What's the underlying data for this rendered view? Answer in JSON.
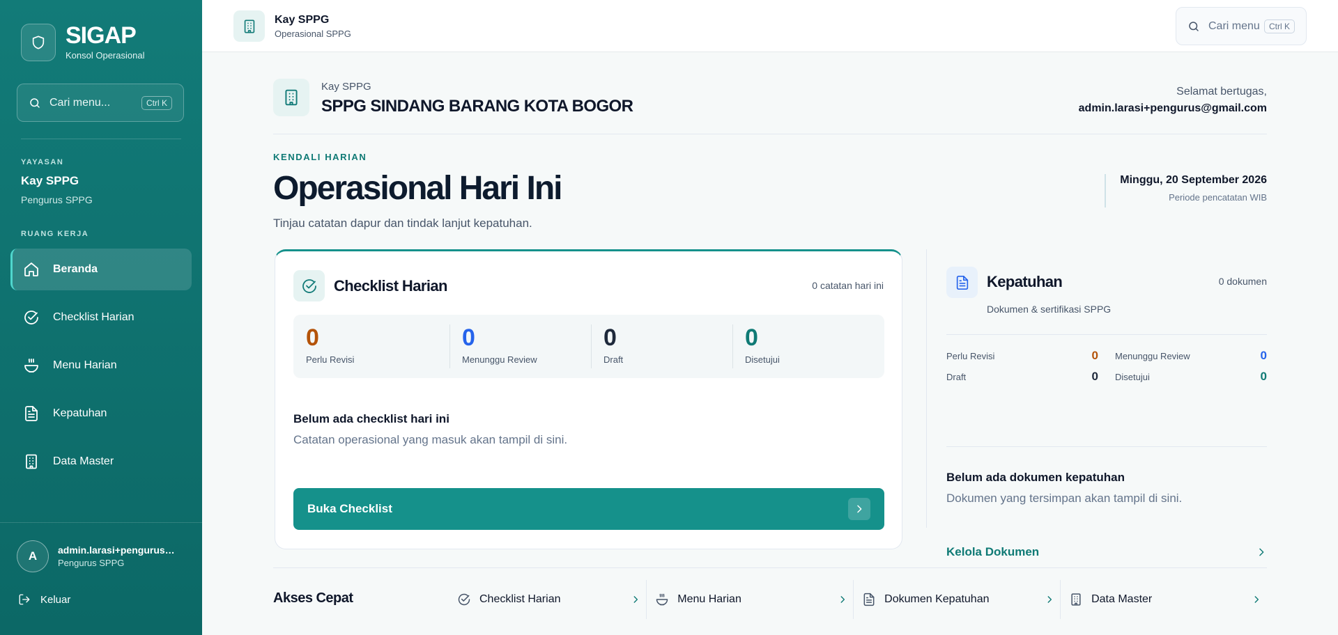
{
  "brand": {
    "title": "SIGAP",
    "subtitle": "Konsol Operasional"
  },
  "sidebar": {
    "search": {
      "placeholder": "Cari menu...",
      "shortcut": "Ctrl K"
    },
    "org_label": "YAYASAN",
    "org_name": "Kay SPPG",
    "org_role": "Pengurus SPPG",
    "workspace_label": "RUANG KERJA",
    "items": [
      {
        "label": "Beranda",
        "icon": "home-icon",
        "active": true
      },
      {
        "label": "Checklist Harian",
        "icon": "check-circle-icon"
      },
      {
        "label": "Menu Harian",
        "icon": "bowl-icon"
      },
      {
        "label": "Kepatuhan",
        "icon": "document-icon"
      },
      {
        "label": "Data Master",
        "icon": "building-icon"
      }
    ],
    "user": {
      "initial": "A",
      "email": "admin.larasi+pengurus@gmail.com",
      "role": "Pengurus SPPG"
    },
    "logout_label": "Keluar"
  },
  "topbar": {
    "title": "Kay SPPG",
    "subtitle": "Operasional SPPG",
    "search": {
      "placeholder": "Cari menu",
      "shortcut": "Ctrl K"
    }
  },
  "site": {
    "pre": "Kay SPPG",
    "name": "SPPG SINDANG BARANG KOTA BOGOR",
    "greeting": "Selamat bertugas,",
    "email": "admin.larasi+pengurus@gmail.com"
  },
  "page": {
    "eyebrow": "KENDALI HARIAN",
    "title": "Operasional Hari Ini",
    "description": "Tinjau catatan dapur dan tindak lanjut kepatuhan.",
    "date": "Minggu, 20 September 2026",
    "date_note": "Periode pencatatan WIB"
  },
  "checklist": {
    "title": "Checklist Harian",
    "count_text": "0 catatan hari ini",
    "stats": [
      {
        "value": "0",
        "label": "Perlu Revisi",
        "color": "#b45309"
      },
      {
        "value": "0",
        "label": "Menunggu Review",
        "color": "#2563eb"
      },
      {
        "value": "0",
        "label": "Draft",
        "color": "#1e293b"
      },
      {
        "value": "0",
        "label": "Disetujui",
        "color": "#0f7a75"
      }
    ],
    "empty_title": "Belum ada checklist hari ini",
    "empty_desc": "Catatan operasional yang masuk akan tampil di sini.",
    "cta": "Buka Checklist"
  },
  "compliance": {
    "title": "Kepatuhan",
    "count_text": "0 dokumen",
    "subtitle": "Dokumen & sertifikasi SPPG",
    "stats": [
      {
        "label": "Perlu Revisi",
        "value": "0",
        "color": "#b45309"
      },
      {
        "label": "Menunggu Review",
        "value": "0",
        "color": "#2563eb"
      },
      {
        "label": "Draft",
        "value": "0",
        "color": "#1e293b"
      },
      {
        "label": "Disetujui",
        "value": "0",
        "color": "#0f7a75"
      }
    ],
    "empty_title": "Belum ada dokumen kepatuhan",
    "empty_desc": "Dokumen yang tersimpan akan tampil di sini.",
    "link": "Kelola Dokumen"
  },
  "quick": {
    "title": "Akses Cepat",
    "items": [
      {
        "label": "Checklist Harian",
        "icon": "check-circle-icon"
      },
      {
        "label": "Menu Harian",
        "icon": "bowl-icon"
      },
      {
        "label": "Dokumen Kepatuhan",
        "icon": "document-icon"
      },
      {
        "label": "Data Master",
        "icon": "building-icon"
      }
    ]
  },
  "colors": {
    "brand": "#127b78",
    "accent": "#15918b",
    "amber": "#b45309",
    "blue": "#2563eb"
  }
}
